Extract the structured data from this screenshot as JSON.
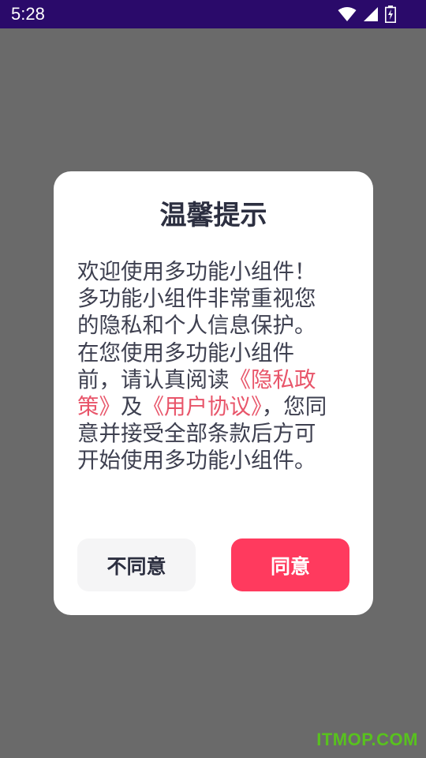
{
  "status_bar": {
    "time": "5:28",
    "icons": [
      "wifi-icon",
      "cellular-signal-icon",
      "battery-charging-icon"
    ],
    "background": "#2a0a6a"
  },
  "dialog": {
    "title": "温馨提示",
    "body": {
      "part1": "欢迎使用多功能小组件！多功能小组件非常重视您的隐私和个人信息保护。在您使用多功能小组件前，请认真阅读",
      "privacy_link": "《隐私政策》",
      "part2": "及",
      "agreement_link": "《用户协议》",
      "part3": "，您同意并接受全部条款后方可开始使用多功能小组件。"
    },
    "buttons": {
      "disagree_label": "不同意",
      "agree_label": "同意"
    }
  },
  "watermark": "ITMOP.COM",
  "colors": {
    "overlay": "#6a6a6a",
    "link": "#e8556a",
    "agree_button": "#ff3a5e",
    "watermark": "#58c21e"
  }
}
